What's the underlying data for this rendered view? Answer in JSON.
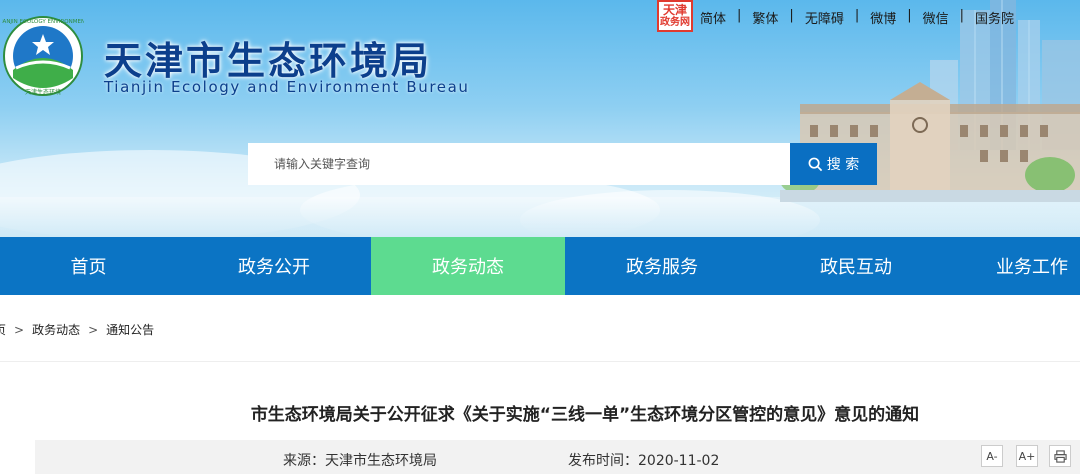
{
  "header": {
    "title_cn": "天津市生态环境局",
    "title_en": "Tianjin Ecology and Environment Bureau",
    "logo_text": "TIANJIN ECOLOGY ENVIRONMENT",
    "logo_text_bottom": "天津生态环境",
    "stamp_line1": "天津",
    "stamp_line2": "政务",
    "stamp_line3": "网"
  },
  "toplinks": [
    "简体",
    "繁体",
    "无障碍",
    "微博",
    "微信",
    "国务院"
  ],
  "toplink_separator": "|",
  "search": {
    "placeholder": "请输入关键字查询",
    "button_label": "搜 索"
  },
  "nav": [
    {
      "label": "首页",
      "active": false
    },
    {
      "label": "政务公开",
      "active": false
    },
    {
      "label": "政务动态",
      "active": true
    },
    {
      "label": "政务服务",
      "active": false
    },
    {
      "label": "政民互动",
      "active": false
    },
    {
      "label": "业务工作",
      "active": false
    }
  ],
  "breadcrumb": [
    "页",
    "政务动态",
    "通知公告"
  ],
  "breadcrumb_separator": ">",
  "article": {
    "title": "市生态环境局关于公开征求《关于实施“三线一单”生态环境分区管控的意见》意见的通知",
    "source": "来源：天津市生态环境局",
    "date": "发布时间：2020-11-02"
  },
  "tools": {
    "font_decrease": "A-",
    "font_increase": "A+"
  },
  "colors": {
    "nav_bg": "#0b74c4",
    "nav_active": "#5ddb90",
    "search_button": "#0a6fc2",
    "title_color": "#0c3f8c"
  }
}
